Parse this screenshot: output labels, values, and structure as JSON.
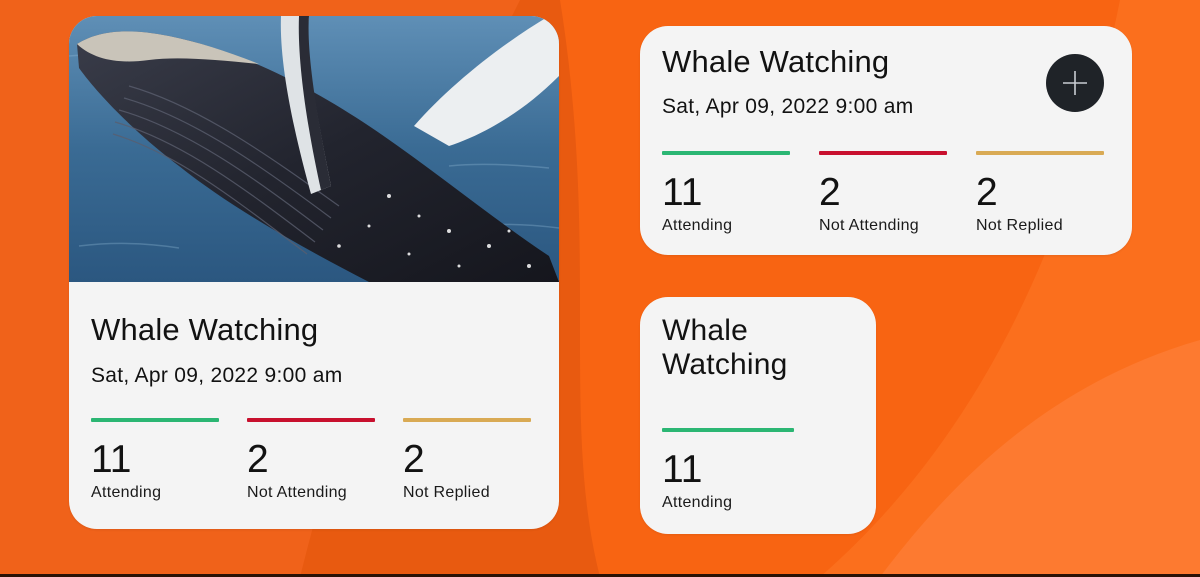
{
  "colors": {
    "background": "#ea5a0e",
    "card": "#f4f4f4",
    "attending": "#2bb673",
    "not_attending": "#c8102e",
    "not_replied": "#d9aa54",
    "add_button": "#1f2328"
  },
  "widget_large": {
    "image_icon": "humpback-whale-photo",
    "title": "Whale Watching",
    "date": "Sat, Apr 09, 2022 9:00 am",
    "stats": [
      {
        "count": "11",
        "label": "Attending"
      },
      {
        "count": "2",
        "label": "Not Attending"
      },
      {
        "count": "2",
        "label": "Not Replied"
      }
    ]
  },
  "widget_medium": {
    "title": "Whale Watching",
    "date": "Sat, Apr 09, 2022 9:00 am",
    "add_icon": "plus-icon",
    "stats": [
      {
        "count": "11",
        "label": "Attending"
      },
      {
        "count": "2",
        "label": "Not Attending"
      },
      {
        "count": "2",
        "label": "Not Replied"
      }
    ]
  },
  "widget_small": {
    "title": "Whale Watching",
    "stats": [
      {
        "count": "11",
        "label": "Attending"
      }
    ]
  }
}
